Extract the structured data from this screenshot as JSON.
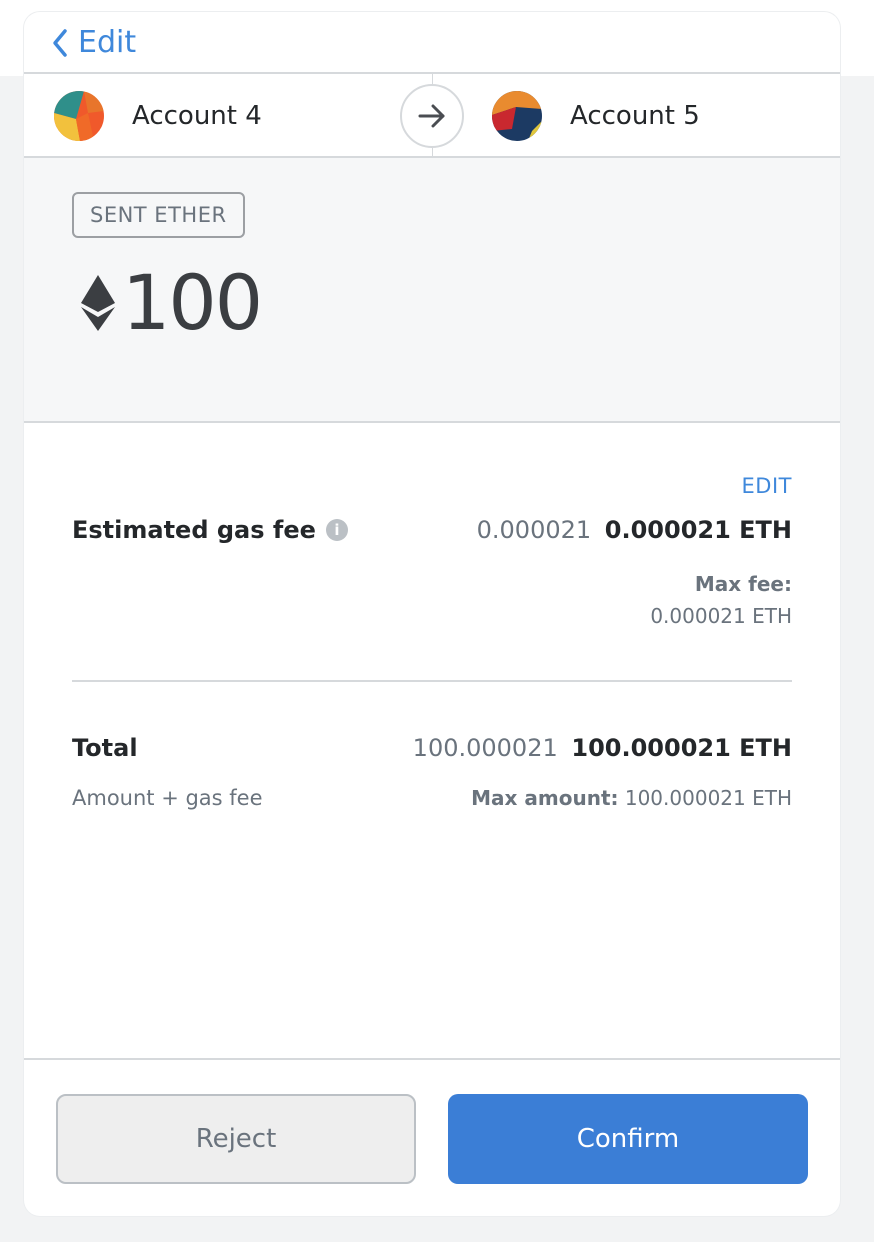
{
  "header": {
    "back_label": "Edit"
  },
  "accounts": {
    "from": {
      "name": "Account 4"
    },
    "to": {
      "name": "Account 5"
    }
  },
  "transaction": {
    "type_badge": "SENT ETHER",
    "amount": "100"
  },
  "gas": {
    "edit_label": "EDIT",
    "label": "Estimated gas fee",
    "secondary_value": "0.000021",
    "primary_value": "0.000021 ETH",
    "max_fee_label": "Max fee:",
    "max_fee_value": "0.000021 ETH"
  },
  "total": {
    "label": "Total",
    "secondary_value": "100.000021",
    "primary_value": "100.000021 ETH",
    "sub_label": "Amount + gas fee",
    "max_amount_label": "Max amount:",
    "max_amount_value": "100.000021 ETH"
  },
  "footer": {
    "reject_label": "Reject",
    "confirm_label": "Confirm"
  },
  "colors": {
    "accent": "#3b7ed6",
    "link": "#3f88db"
  }
}
